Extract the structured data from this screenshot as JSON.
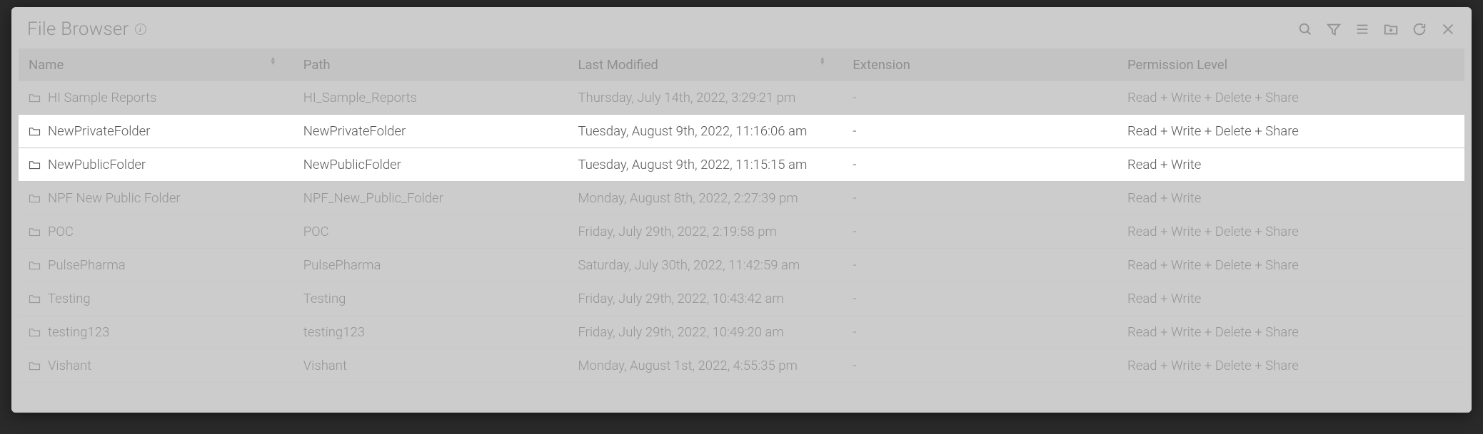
{
  "title": "File Browser",
  "toolbar": {
    "search": "Search",
    "filter": "Filter",
    "list": "List",
    "newfolder": "New folder",
    "refresh": "Refresh",
    "close": "Close"
  },
  "columns": {
    "name": "Name",
    "path": "Path",
    "modified": "Last Modified",
    "extension": "Extension",
    "permission": "Permission Level"
  },
  "rows": [
    {
      "highlight": false,
      "name": "HI Sample Reports",
      "path": "HI_Sample_Reports",
      "modified": "Thursday, July 14th, 2022, 3:29:21 pm",
      "extension": "-",
      "permission": "Read + Write + Delete + Share"
    },
    {
      "highlight": true,
      "name": "NewPrivateFolder",
      "path": "NewPrivateFolder",
      "modified": "Tuesday, August 9th, 2022, 11:16:06 am",
      "extension": "-",
      "permission": "Read + Write + Delete + Share"
    },
    {
      "highlight": true,
      "name": "NewPublicFolder",
      "path": "NewPublicFolder",
      "modified": "Tuesday, August 9th, 2022, 11:15:15 am",
      "extension": "-",
      "permission": "Read + Write"
    },
    {
      "highlight": false,
      "name": "NPF New Public Folder",
      "path": "NPF_New_Public_Folder",
      "modified": "Monday, August 8th, 2022, 2:27:39 pm",
      "extension": "-",
      "permission": "Read + Write"
    },
    {
      "highlight": false,
      "name": "POC",
      "path": "POC",
      "modified": "Friday, July 29th, 2022, 2:19:58 pm",
      "extension": "-",
      "permission": "Read + Write + Delete + Share"
    },
    {
      "highlight": false,
      "name": "PulsePharma",
      "path": "PulsePharma",
      "modified": "Saturday, July 30th, 2022, 11:42:59 am",
      "extension": "-",
      "permission": "Read + Write + Delete + Share"
    },
    {
      "highlight": false,
      "name": "Testing",
      "path": "Testing",
      "modified": "Friday, July 29th, 2022, 10:43:42 am",
      "extension": "-",
      "permission": "Read + Write"
    },
    {
      "highlight": false,
      "name": "testing123",
      "path": "testing123",
      "modified": "Friday, July 29th, 2022, 10:49:20 am",
      "extension": "-",
      "permission": "Read + Write + Delete + Share"
    },
    {
      "highlight": false,
      "name": "Vishant",
      "path": "Vishant",
      "modified": "Monday, August 1st, 2022, 4:55:35 pm",
      "extension": "-",
      "permission": "Read + Write + Delete + Share"
    }
  ]
}
